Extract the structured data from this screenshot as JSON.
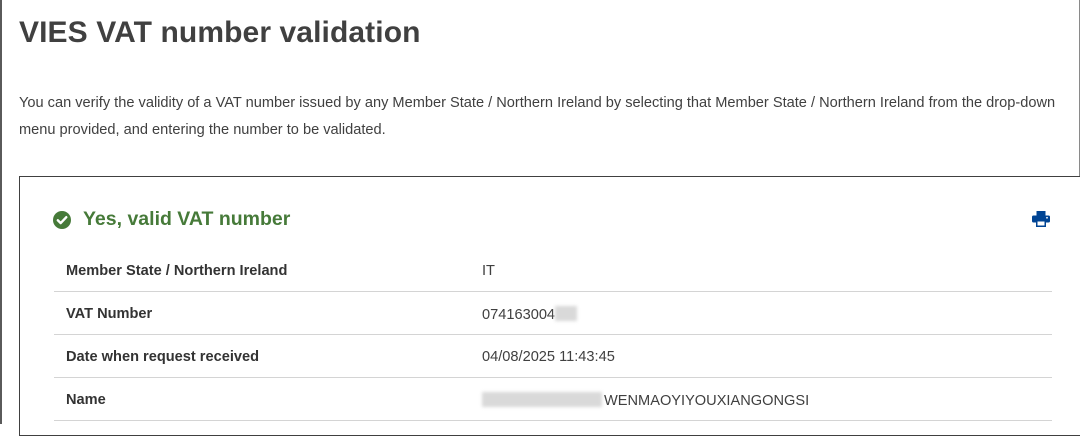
{
  "page": {
    "title": "VIES VAT number validation",
    "intro": "You can verify the validity of a VAT number issued by any Member State / Northern Ireland by selecting that Member State / Northern Ireland from the drop-down menu provided, and entering the number to be validated."
  },
  "result": {
    "status": "Yes, valid VAT number",
    "status_color": "#467a39",
    "status_icon": "check-circle-icon",
    "print_icon": "print-icon",
    "print_icon_color": "#004494",
    "rows": [
      {
        "label": "Member State / Northern Ireland",
        "value": "IT"
      },
      {
        "label": "VAT Number",
        "value": "074163004"
      },
      {
        "label": "Date when request received",
        "value": "04/08/2025 11:43:45"
      },
      {
        "label": "Name",
        "value": "WENMAOYIYOUXIANGONGSI"
      }
    ]
  }
}
